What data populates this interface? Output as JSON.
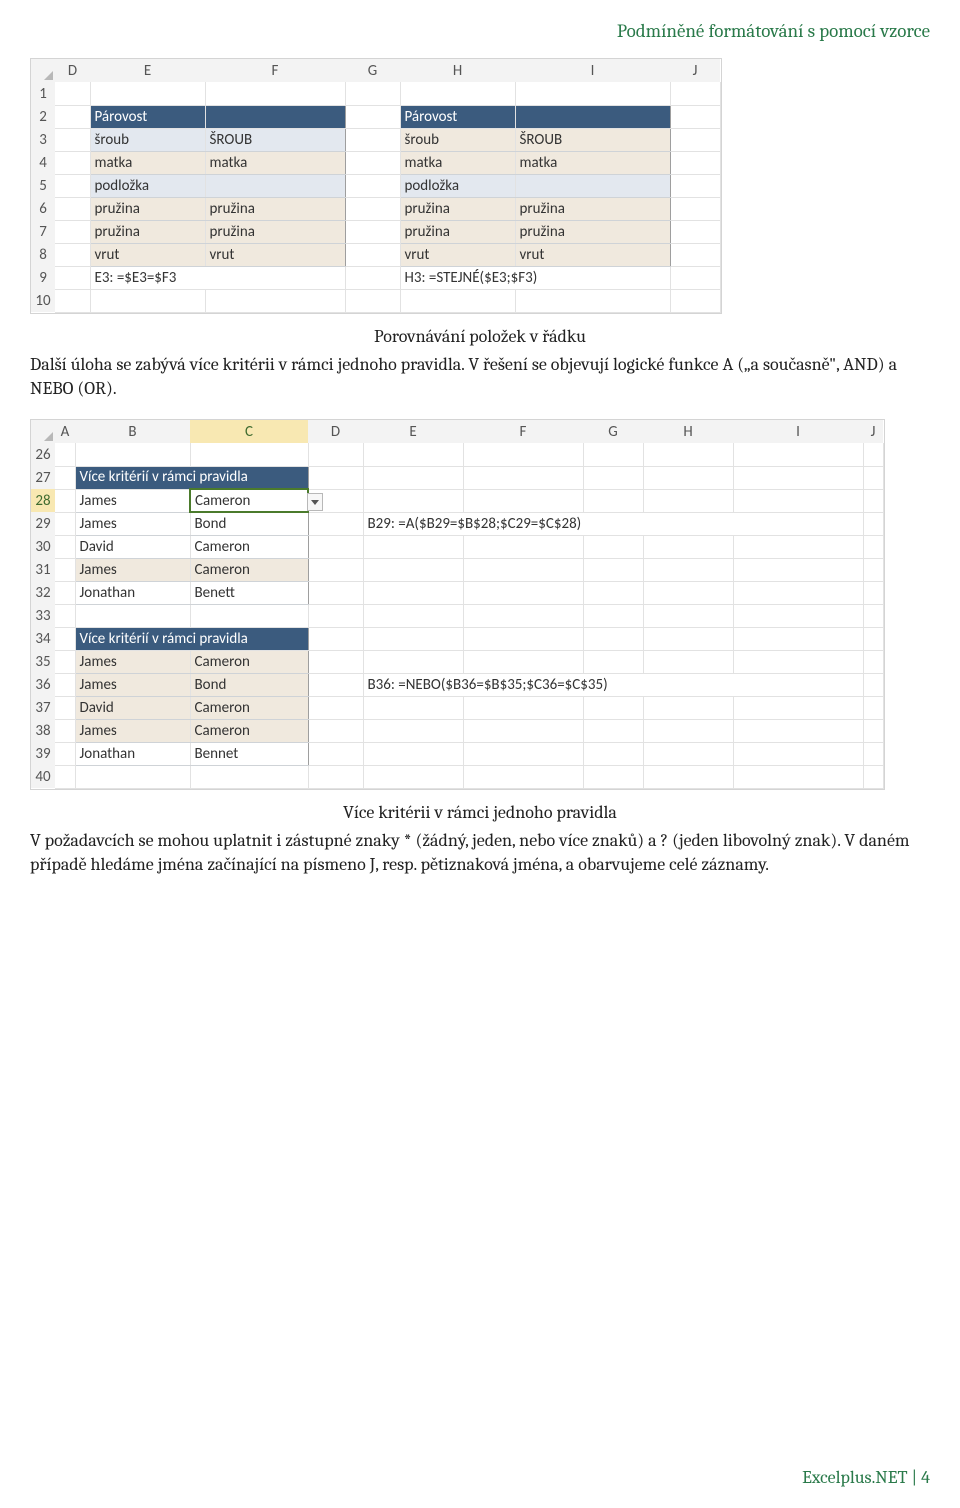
{
  "header": {
    "title": "Podmíněné formátování s pomocí vzorce"
  },
  "ss1": {
    "cols": [
      "D",
      "E",
      "F",
      "G",
      "H",
      "I",
      "J"
    ],
    "rows": [
      "1",
      "2",
      "3",
      "4",
      "5",
      "6",
      "7",
      "8",
      "9",
      "10"
    ],
    "header_left": "Párovost",
    "header_right": "Párovost",
    "left": [
      {
        "e": "šroub",
        "f": "ŠROUB",
        "shade": "blue"
      },
      {
        "e": "matka",
        "f": "matka",
        "shade": "tan"
      },
      {
        "e": "podložka",
        "f": "",
        "shade": "blue"
      },
      {
        "e": "pružina",
        "f": "pružina",
        "shade": "tan"
      },
      {
        "e": "pružina",
        "f": "pružina",
        "shade": "tan"
      },
      {
        "e": "vrut",
        "f": "vrut",
        "shade": "tan"
      }
    ],
    "right": [
      {
        "h": "šroub",
        "i": "ŠROUB",
        "shade": "tan"
      },
      {
        "h": "matka",
        "i": "matka",
        "shade": "tan"
      },
      {
        "h": "podložka",
        "i": "",
        "shade": "blue"
      },
      {
        "h": "pružina",
        "i": "pružina",
        "shade": "tan"
      },
      {
        "h": "pružina",
        "i": "pružina",
        "shade": "tan"
      },
      {
        "h": "vrut",
        "i": "vrut",
        "shade": "tan"
      }
    ],
    "formula_left": "E3: =$E3=$F3",
    "formula_right": "H3: =STEJNÉ($E3;$F3)"
  },
  "caption1": "Porovnávání položek v řádku",
  "para1": "Další úloha se zabývá více kritérii v rámci jednoho pravidla. V řešení se objevují logické funkce A („a současně\", AND) a NEBO (OR).",
  "ss2": {
    "cols": [
      "A",
      "B",
      "C",
      "D",
      "E",
      "F",
      "G",
      "H",
      "I",
      "J"
    ],
    "selected_col": "C",
    "selected_row": "28",
    "rows": [
      "26",
      "27",
      "28",
      "29",
      "30",
      "31",
      "32",
      "33",
      "34",
      "35",
      "36",
      "37",
      "38",
      "39",
      "40"
    ],
    "block1_title": "Více kritérií v rámci pravidla",
    "block1": [
      {
        "b": "James",
        "c": "Cameron",
        "active": true
      },
      {
        "b": "James",
        "c": "Bond",
        "formula": "B29: =A($B29=$B$28;$C29=$C$28)"
      },
      {
        "b": "David",
        "c": "Cameron"
      },
      {
        "b": "James",
        "c": "Cameron",
        "hl": true
      },
      {
        "b": "Jonathan",
        "c": "Benett"
      }
    ],
    "block2_title": "Více kritérií v rámci pravidla",
    "block2": [
      {
        "b": "James",
        "c": "Cameron",
        "hl": true
      },
      {
        "b": "James",
        "c": "Bond",
        "hl": true,
        "formula": "B36: =NEBO($B36=$B$35;$C36=$C$35)"
      },
      {
        "b": "David",
        "c": "Cameron",
        "hl": true
      },
      {
        "b": "James",
        "c": "Cameron",
        "hl": true
      },
      {
        "b": "Jonathan",
        "c": "Bennet"
      }
    ]
  },
  "caption2": "Více kritérii v rámci jednoho pravidla",
  "para2": "V požadavcích se mohou uplatnit i zástupné znaky * (žádný, jeden, nebo více znaků) a ? (jeden libovolný znak). V daném případě hledáme jména začínající na písmeno J, resp. pětiznaková jména, a obarvujeme celé záznamy.",
  "footer": {
    "site": "Excelplus.NET",
    "sep": " | ",
    "page": "4"
  }
}
